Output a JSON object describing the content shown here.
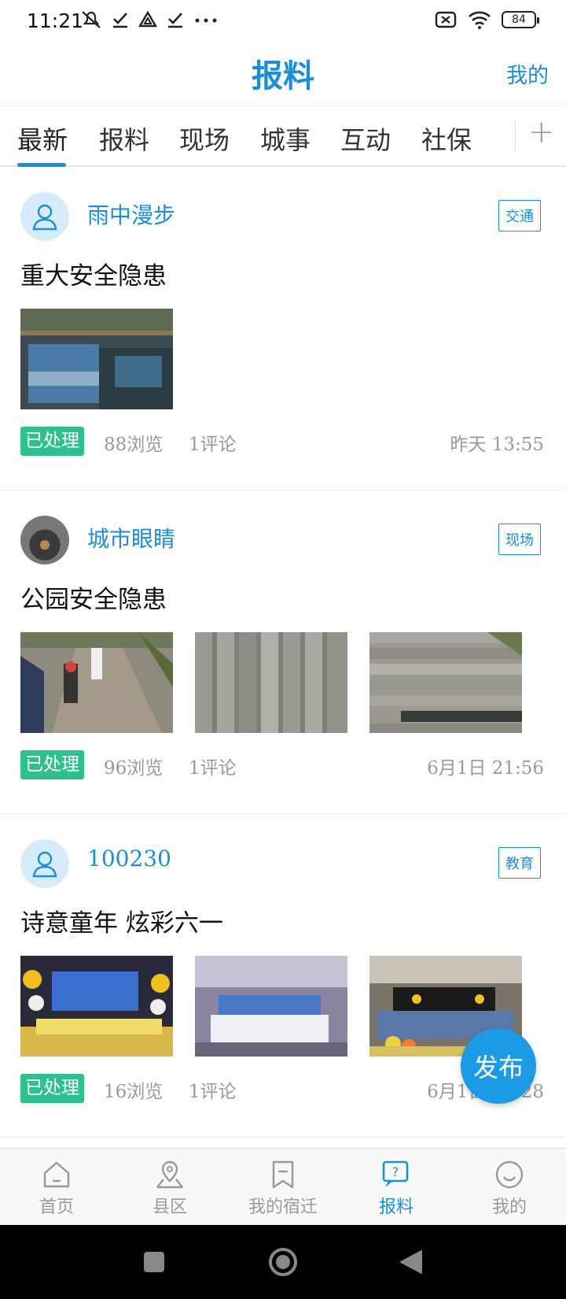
{
  "status_bar": {
    "time": "11:21",
    "battery": "84"
  },
  "header": {
    "title": "报料",
    "right_link": "我的"
  },
  "tabs": [
    {
      "label": "最新",
      "active": true
    },
    {
      "label": "报料"
    },
    {
      "label": "现场"
    },
    {
      "label": "城事"
    },
    {
      "label": "互动"
    },
    {
      "label": "社保"
    }
  ],
  "posts": [
    {
      "user": "雨中漫步",
      "tag": "交通",
      "title": "重大安全隐患",
      "status": "已处理",
      "views": "88浏览",
      "comments": "1评论",
      "time": "昨天  13:55"
    },
    {
      "user": "城市眼睛",
      "tag": "现场",
      "title": "公园安全隐患",
      "status": "已处理",
      "views": "96浏览",
      "comments": "1评论",
      "time": "6月1日  21:56"
    },
    {
      "user": "100230",
      "tag": "教育",
      "title": "诗意童年  炫彩六一",
      "status": "已处理",
      "views": "16浏览",
      "comments": "1评论",
      "time": "6月1日  08:28"
    }
  ],
  "fab": {
    "label": "发布"
  },
  "bottom_nav": [
    {
      "label": "首页",
      "icon": "home-icon"
    },
    {
      "label": "县区",
      "icon": "map-pin-icon"
    },
    {
      "label": "我的宿迁",
      "icon": "bookmark-icon"
    },
    {
      "label": "报料",
      "icon": "report-icon",
      "active": true
    },
    {
      "label": "我的",
      "icon": "smile-icon"
    }
  ],
  "colors": {
    "accent": "#1a8fd8",
    "badge": "#2fc08f"
  }
}
